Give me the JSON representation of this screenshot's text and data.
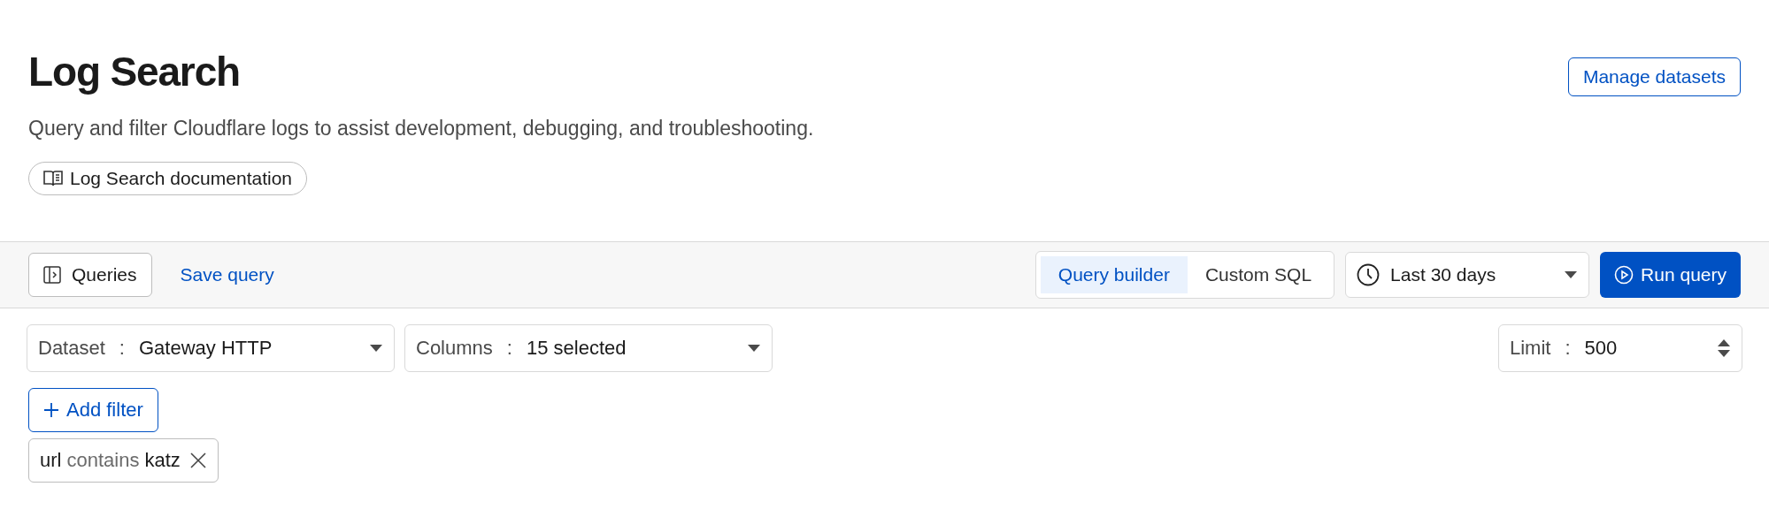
{
  "header": {
    "title": "Log Search",
    "description": "Query and filter Cloudflare logs to assist development, debugging, and troubleshooting.",
    "doc_link": "Log Search documentation",
    "manage_button": "Manage datasets"
  },
  "toolbar": {
    "queries_button": "Queries",
    "save_link": "Save query",
    "modes": [
      {
        "label": "Query builder",
        "selected": true
      },
      {
        "label": "Custom SQL",
        "selected": false
      }
    ],
    "time_range": "Last 30 days",
    "run_button": "Run query"
  },
  "selectors": [
    {
      "kind": "dropdown",
      "label": "Dataset",
      "separator": ":",
      "value": "Gateway HTTP"
    },
    {
      "kind": "dropdown",
      "label": "Columns",
      "separator": ":",
      "value": "15 selected"
    }
  ],
  "limit": {
    "kind": "stepper",
    "label": "Limit",
    "separator": ":",
    "value": "500"
  },
  "add_filter": "Add filter",
  "filters": [
    {
      "field": "url",
      "operator": "contains",
      "value": "katz"
    }
  ]
}
